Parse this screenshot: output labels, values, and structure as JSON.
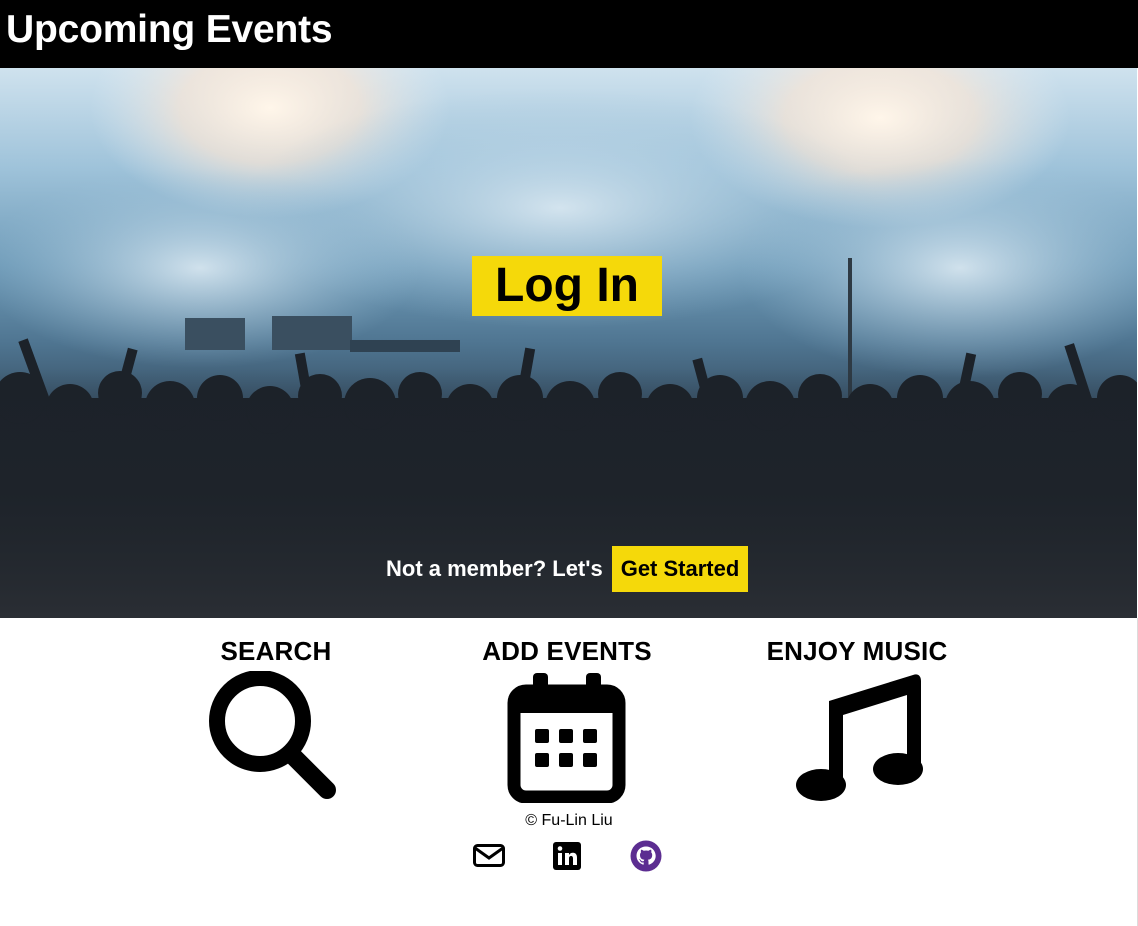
{
  "header": {
    "title": "Upcoming Events"
  },
  "hero": {
    "login_label": "Log In",
    "member_text": "Not a member? Let's",
    "get_started_label": "Get Started"
  },
  "features": [
    {
      "title": "SEARCH",
      "icon": "search-icon"
    },
    {
      "title": "ADD EVENTS",
      "icon": "calendar-icon"
    },
    {
      "title": "ENJOY MUSIC",
      "icon": "music-icon"
    }
  ],
  "footer": {
    "copyright": "© Fu-Lin Liu",
    "links": [
      {
        "icon": "envelope-icon"
      },
      {
        "icon": "linkedin-icon"
      },
      {
        "icon": "github-icon",
        "color": "#5c2d91"
      }
    ]
  },
  "colors": {
    "accent": "#f5d90a",
    "header_bg": "#000000"
  }
}
